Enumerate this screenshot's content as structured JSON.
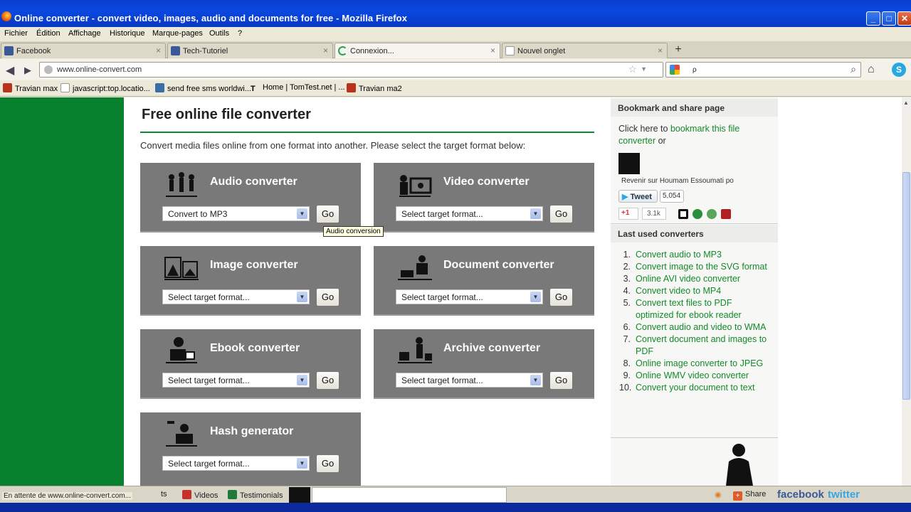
{
  "window": {
    "title": "Online converter - convert video, images, audio and documents for free - Mozilla Firefox",
    "controls": {
      "minimize": "_",
      "maximize": "□",
      "close": "✕"
    }
  },
  "menu": [
    "Fichier",
    "Édition",
    "Affichage",
    "Historique",
    "Marque-pages",
    "Outils",
    "?"
  ],
  "tabs": [
    {
      "label": "Facebook",
      "icon": "facebook-icon",
      "color": "#3b5998"
    },
    {
      "label": "Tech-Tutoriel",
      "icon": "facebook-icon",
      "color": "#3b5998"
    },
    {
      "label": "Connexion...",
      "icon": "loading-icon",
      "color": "#2aa34a"
    },
    {
      "label": "Nouvel onglet",
      "icon": "blank-page-icon",
      "color": "#dddddd"
    }
  ],
  "nav": {
    "url": "www.online-convert.com",
    "search_text": "ρ"
  },
  "bookmarks": [
    {
      "label": "Travian max",
      "color": "#b8321c"
    },
    {
      "label": "javascript:top.locatio...",
      "color": "#ffffff"
    },
    {
      "label": "send free sms worldwi...",
      "color": "#3a6ea5"
    },
    {
      "label": "Home | TomTest.net | ...",
      "color": "#ffffff"
    },
    {
      "label": "Travian ma2",
      "color": "#b8321c"
    }
  ],
  "main": {
    "heading": "Free online file converter",
    "intro": "Convert media files online from one format into another. Please select the target format below:",
    "converters": [
      {
        "name": "Audio converter",
        "select": "Convert to MP3",
        "go": "Go"
      },
      {
        "name": "Video converter",
        "select": "Select target format...",
        "go": "Go"
      },
      {
        "name": "Image converter",
        "select": "Select target format...",
        "go": "Go"
      },
      {
        "name": "Document converter",
        "select": "Select target format...",
        "go": "Go"
      },
      {
        "name": "Ebook converter",
        "select": "Select target format...",
        "go": "Go"
      },
      {
        "name": "Archive converter",
        "select": "Select target format...",
        "go": "Go"
      },
      {
        "name": "Hash generator",
        "select": "Select target format...",
        "go": "Go"
      }
    ],
    "tooltip": "Audio conversion"
  },
  "sidebar": {
    "bookmark_header": "Bookmark and share page",
    "bookmark_text_pre": "Click here to ",
    "bookmark_link": "bookmark this file converter",
    "bookmark_text_post": " or",
    "revenir": "Revenir sur Houmam Essoumati po",
    "tweet": "Tweet",
    "tweet_count": "5,054",
    "gplus": "+1",
    "gplus_count": "3.1k",
    "last_used_header": "Last used converters",
    "last_used": [
      "Convert audio to MP3",
      "Convert image to the SVG format",
      "Online AVI video converter",
      "Convert video to MP4",
      "Convert text files to PDF optimized for ebook reader",
      "Convert audio and video to WMA",
      "Convert document and images to PDF",
      "Online image converter to JPEG",
      "Online WMV video converter",
      "Convert your document to text"
    ]
  },
  "status": {
    "text": "En attente de www.online-convert.com...",
    "partial": "ts",
    "videos": "Videos",
    "testimonials": "Testimonials",
    "share": "Share",
    "facebook": "facebook",
    "twitter": "twitter"
  },
  "colors": {
    "accent_green": "#07812d",
    "link_green": "#138a2a",
    "panel_gray": "#797979"
  }
}
